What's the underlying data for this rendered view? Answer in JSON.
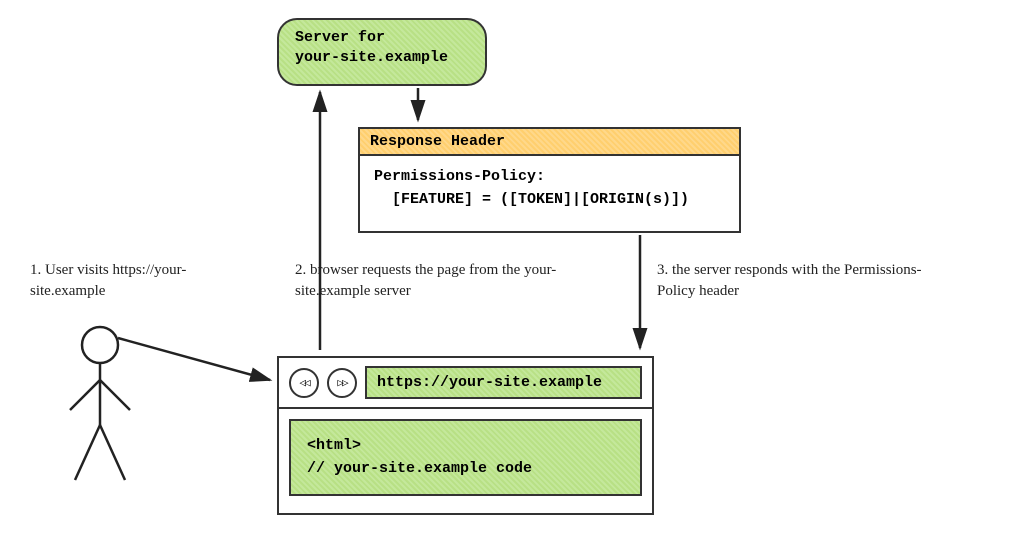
{
  "server": {
    "line1": "Server for",
    "line2": "your-site.example"
  },
  "response": {
    "header_label": "Response Header",
    "policy_label": "Permissions-Policy:",
    "policy_value": "[FEATURE] = ([TOKEN]|[ORIGIN(s)])"
  },
  "browser": {
    "back_glyph": "◁◁",
    "fwd_glyph": "▷▷",
    "url": "https://your-site.example",
    "code_line1": "<html>",
    "code_line2": "// your-site.example code"
  },
  "captions": {
    "step1": "1. User visits https://your-site.example",
    "step2": "2. browser requests the page from the your-site.example server",
    "step3": "3. the server responds with the Permissions-Policy header"
  },
  "colors": {
    "green": "#b8e085",
    "orange": "#ffcf6e",
    "border": "#333333"
  }
}
